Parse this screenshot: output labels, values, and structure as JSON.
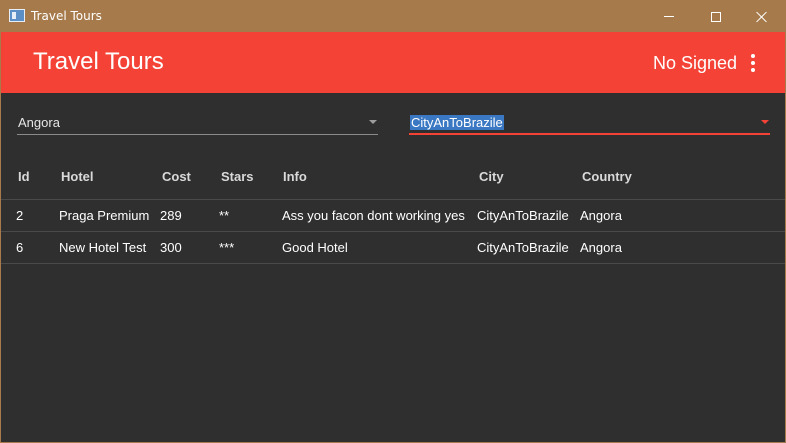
{
  "window": {
    "title": "Travel Tours"
  },
  "appbar": {
    "brand": "Travel Tours",
    "user_status": "No Signed"
  },
  "filters": {
    "country_selected": "Angora",
    "city_selected": "CityAnToBrazile"
  },
  "table": {
    "columns": [
      "Id",
      "Hotel",
      "Cost",
      "Stars",
      "Info",
      "City",
      "Country"
    ],
    "rows": [
      [
        "2",
        "Praga Premium",
        "289",
        "**",
        "Ass you facon dont working yes",
        "CityAnToBrazile",
        "Angora"
      ],
      [
        "6",
        "New Hotel Test",
        "300",
        "***",
        "Good Hotel",
        "CityAnToBrazile",
        "Angora"
      ]
    ]
  },
  "colors": {
    "titlebar": "#a67a4a",
    "accent": "#f44336",
    "background": "#2f2f2f",
    "selection": "#3a78c3"
  },
  "icons": {
    "app": "app-window-icon",
    "menu": "more-vert-icon",
    "dropdown": "triangle-down-icon"
  }
}
